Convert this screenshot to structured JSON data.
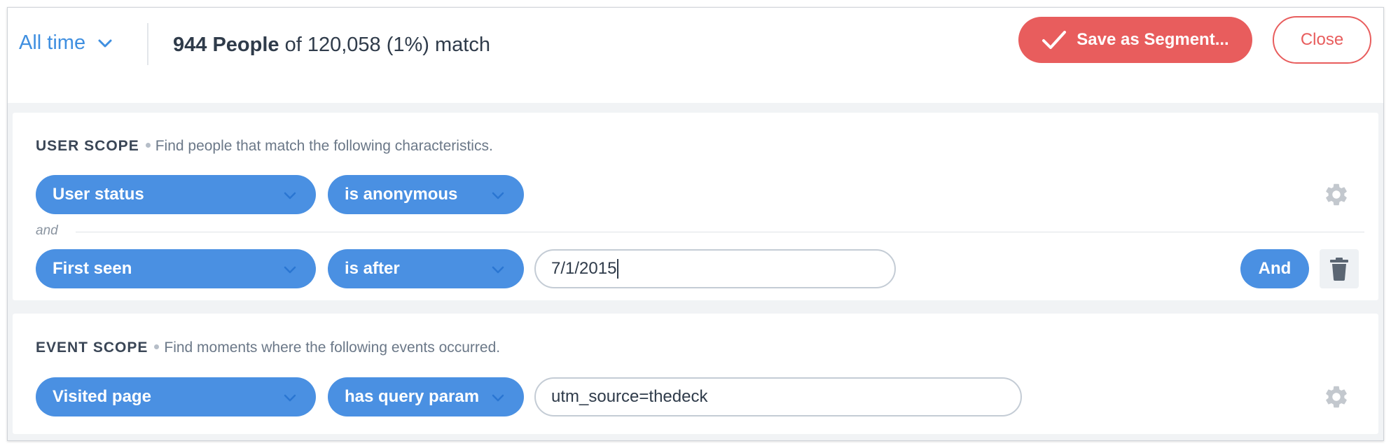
{
  "colors": {
    "accent_blue": "#4a90e2",
    "link_blue": "#3f8fe0",
    "danger_red": "#e85d5d",
    "text_dark": "#2f3b4a",
    "muted": "#6b7888"
  },
  "header": {
    "time_range": "All time",
    "time_range_icon": "chevron-down-icon",
    "match_count": "944 People",
    "match_rest": "of 120,058 (1%) match",
    "save_label": "Save as Segment...",
    "save_icon": "checkmark-icon",
    "close_label": "Close"
  },
  "user_scope": {
    "title": "USER SCOPE",
    "description": "Find people that match the following characteristics.",
    "conditions": [
      {
        "property": "User status",
        "operator": "is anonymous"
      },
      {
        "property": "First seen",
        "operator": "is after",
        "value": "7/1/2015"
      }
    ],
    "joiner": "and",
    "and_button": "And",
    "settings_icon": "gear-icon",
    "delete_icon": "trash-icon"
  },
  "event_scope": {
    "title": "EVENT SCOPE",
    "description": "Find moments where the following events occurred.",
    "conditions": [
      {
        "property": "Visited page",
        "operator": "has query param",
        "value": "utm_source=thedeck"
      }
    ],
    "settings_icon": "gear-icon"
  }
}
